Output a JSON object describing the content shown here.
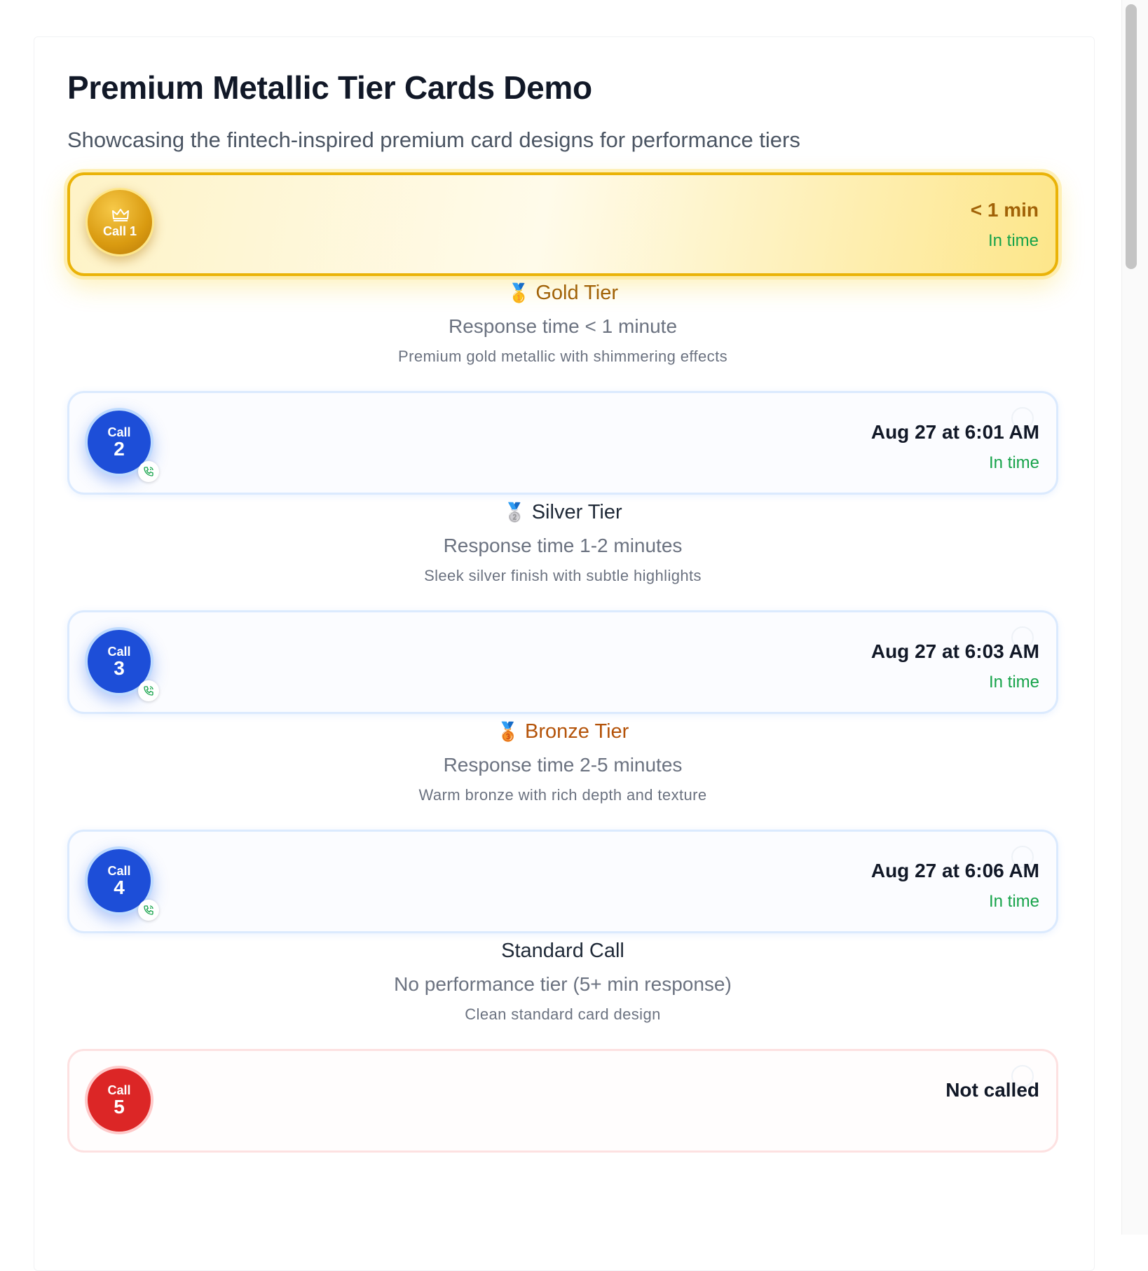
{
  "page": {
    "title": "Premium Metallic Tier Cards Demo",
    "subtitle": "Showcasing the fintech-inspired premium card designs for performance tiers"
  },
  "colors": {
    "gold": "#eab308",
    "gold_text": "#a16207",
    "bronze_text": "#b45309",
    "call_blue": "#1d4ed8",
    "status_green": "#16a34a",
    "missed_red": "#dc2626"
  },
  "cards": [
    {
      "badge_icon": "crown-icon",
      "badge_label": "Call 1",
      "time": "< 1 min",
      "status": "In time"
    },
    {
      "badge_word": "Call",
      "badge_number": "2",
      "badge_icon": "phone-icon",
      "time": "Aug 27 at 6:01 AM",
      "status": "In time"
    },
    {
      "badge_word": "Call",
      "badge_number": "3",
      "badge_icon": "phone-icon",
      "time": "Aug 27 at 6:03 AM",
      "status": "In time"
    },
    {
      "badge_word": "Call",
      "badge_number": "4",
      "badge_icon": "phone-icon",
      "time": "Aug 27 at 6:06 AM",
      "status": "In time"
    },
    {
      "badge_word": "Call",
      "badge_number": "5",
      "time": "Not called"
    }
  ],
  "tiers": [
    {
      "medal": "🥇",
      "medal_icon": "gold-medal-icon",
      "name": "Gold Tier",
      "response": "Response time < 1 minute",
      "description": "Premium gold metallic with shimmering effects"
    },
    {
      "medal": "🥈",
      "medal_icon": "silver-medal-icon",
      "name": "Silver Tier",
      "response": "Response time 1-2 minutes",
      "description": "Sleek silver finish with subtle highlights"
    },
    {
      "medal": "🥉",
      "medal_icon": "bronze-medal-icon",
      "name": "Bronze Tier",
      "response": "Response time 2-5 minutes",
      "description": "Warm bronze with rich depth and texture"
    },
    {
      "name": "Standard Call",
      "response": "No performance tier (5+ min response)",
      "description": "Clean standard card design"
    }
  ]
}
